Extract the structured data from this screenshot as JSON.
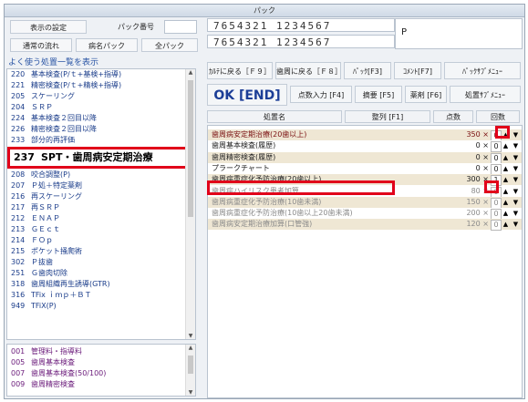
{
  "window": {
    "title": "パック"
  },
  "top": {
    "settings_button": "表示の設定",
    "pack_number_label": "パック番号",
    "pack_number_value": "",
    "normal_flow_button": "通常の流れ",
    "disease_pack_button": "病名パック",
    "all_pack_button": "全パック",
    "digits_row1": "7654321 1234567",
    "digits_row2": "7654321 1234567",
    "p_label": "P"
  },
  "left_top": {
    "header": "よく使う処置一覧を表示",
    "items": [
      {
        "code": "220",
        "label": "基本検査(P/ｔ+基検+指導)"
      },
      {
        "code": "221",
        "label": "精密検査(P/ｔ+精検+指導)"
      },
      {
        "code": "205",
        "label": "スケーリング"
      },
      {
        "code": "204",
        "label": "ＳＲＰ"
      },
      {
        "code": "224",
        "label": "基本検査２回目以降"
      },
      {
        "code": "226",
        "label": "精密検査２回目以降"
      },
      {
        "code": "233",
        "label": "部分的再評価"
      },
      {
        "code": "237",
        "label": "SPT・歯周病安定期治療"
      },
      {
        "code": "208",
        "label": "咬合調整(P)"
      },
      {
        "code": "207",
        "label": "Ｐ処＋特定薬剤"
      },
      {
        "code": "216",
        "label": "再スケーリング"
      },
      {
        "code": "217",
        "label": "再ＳＲＰ"
      },
      {
        "code": "212",
        "label": "ＥＮＡＰ"
      },
      {
        "code": "213",
        "label": "ＧＥｃｔ"
      },
      {
        "code": "214",
        "label": "ＦＯｐ"
      },
      {
        "code": "215",
        "label": "ポケット掻爬術"
      },
      {
        "code": "302",
        "label": "Ｐ抜歯"
      },
      {
        "code": "251",
        "label": "Ｇ歯肉切除"
      },
      {
        "code": "318",
        "label": "歯周組織再生誘導(GTR)"
      },
      {
        "code": "316",
        "label": "TFix ｉｍｐ＋ＢＴ"
      },
      {
        "code": "949",
        "label": "TFiX(P)"
      }
    ]
  },
  "left_bottom": {
    "items": [
      {
        "code": "001",
        "label": "管理料・指導料"
      },
      {
        "code": "005",
        "label": "歯周基本検査"
      },
      {
        "code": "007",
        "label": "歯周基本検査(50/100)"
      },
      {
        "code": "009",
        "label": "歯周精密検査"
      }
    ]
  },
  "buttons": {
    "karte_back": "ｶﾙﾃに戻る［Ｆ９］",
    "perio_back": "歯周に戻る［Ｆ８］",
    "pack": "ﾊﾟｯｸ[F3]",
    "comment": "ｺﾒﾝﾄ[F7]",
    "pack_submenu": "ﾊﾟｯｸｻﾌﾞﾒﾆｭｰ",
    "ok_end": "OK [END]",
    "points_input": "点数入力 [F4]",
    "summary": "摘要 [F5]",
    "drug": "薬剤 [F6]",
    "treatment_submenu": "処置ｻﾌﾞﾒﾆｭｰ"
  },
  "grid_headers": {
    "name": "処置名",
    "sort": "整列 [F1]",
    "points": "点数",
    "count": "回数"
  },
  "grid_rows": [
    {
      "name": "歯周病安定期治療(20歯以上)",
      "points": "350",
      "qty": "0",
      "enabled": true
    },
    {
      "name": "歯周基本検査(履歴)",
      "points": "0",
      "qty": "0",
      "enabled": true
    },
    {
      "name": "歯周精密検査(履歴)",
      "points": "0",
      "qty": "0",
      "enabled": true
    },
    {
      "name": "プラークチャート",
      "points": "0",
      "qty": "0",
      "enabled": true
    },
    {
      "name": "歯周病重症化予防治療(20歯以上)",
      "points": "300",
      "qty": "1",
      "enabled": true
    },
    {
      "name": "歯周病ハイリスク患者加算",
      "points": "80",
      "qty": "0",
      "enabled": false
    },
    {
      "name": "歯周病重症化予防治療(10歯未満)",
      "points": "150",
      "qty": "0",
      "enabled": false
    },
    {
      "name": "歯周病重症化予防治療(10歯以上20歯未満)",
      "points": "200",
      "qty": "0",
      "enabled": false
    },
    {
      "name": "歯周病安定期治療加算(口管強)",
      "points": "120",
      "qty": "0",
      "enabled": false
    }
  ],
  "symbols": {
    "times": "×",
    "up": "▲",
    "down": "▼"
  },
  "colors": {
    "highlight_red": "#e1001a",
    "enabled_row": "#efe7d4",
    "disabled_text": "#8a8a8a",
    "link_blue": "#1a3c8a"
  }
}
